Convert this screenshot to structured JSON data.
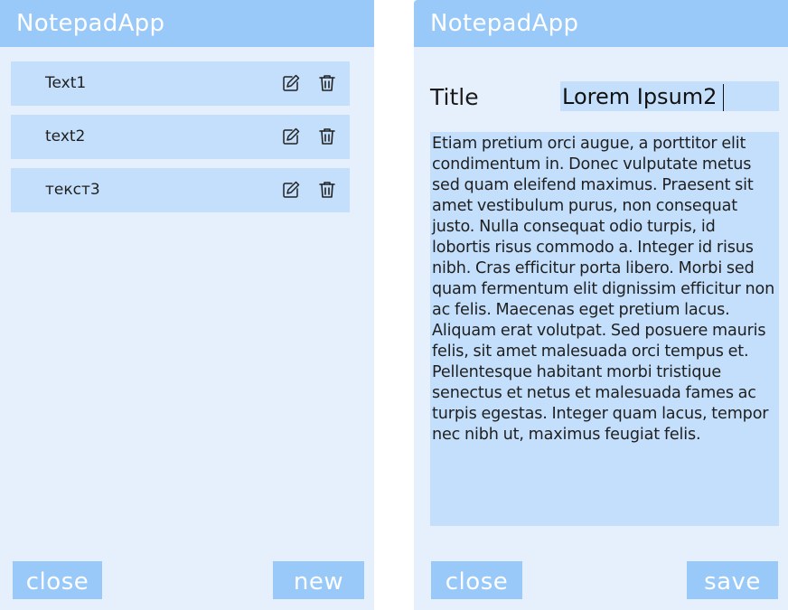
{
  "app": {
    "title": "NotepadApp"
  },
  "list_view": {
    "title": "NotepadApp",
    "notes": [
      {
        "label": "Text1"
      },
      {
        "label": "text2"
      },
      {
        "label": "текст3"
      }
    ],
    "close_label": "close",
    "new_label": "new"
  },
  "edit_view": {
    "title": "NotepadApp",
    "title_label": "Title",
    "title_value": "Lorem Ipsum2",
    "body_value": "Etiam pretium orci augue, a porttitor elit condimentum in. Donec vulputate metus sed quam eleifend maximus. Praesent sit amet vestibulum purus, non consequat justo. Nulla consequat odio turpis, id lobortis risus commodo a. Integer id risus nibh. Cras efficitur porta libero. Morbi sed quam fermentum elit dignissim efficitur non ac felis. Maecenas eget pretium lacus. Aliquam erat volutpat. Sed posuere mauris felis, sit amet malesuada orci tempus et. Pellentesque habitant morbi tristique senectus et netus et malesuada fames ac turpis egestas. Integer quam lacus, tempor nec nibh ut, maximus feugiat felis.",
    "close_label": "close",
    "save_label": "save"
  },
  "icons": {
    "edit": "edit-icon",
    "delete": "trash-icon"
  },
  "colors": {
    "header": "#98c9f9",
    "panel_background": "#e6f0fc",
    "item_background": "#c4dffb",
    "button_text": "#ffffff"
  }
}
